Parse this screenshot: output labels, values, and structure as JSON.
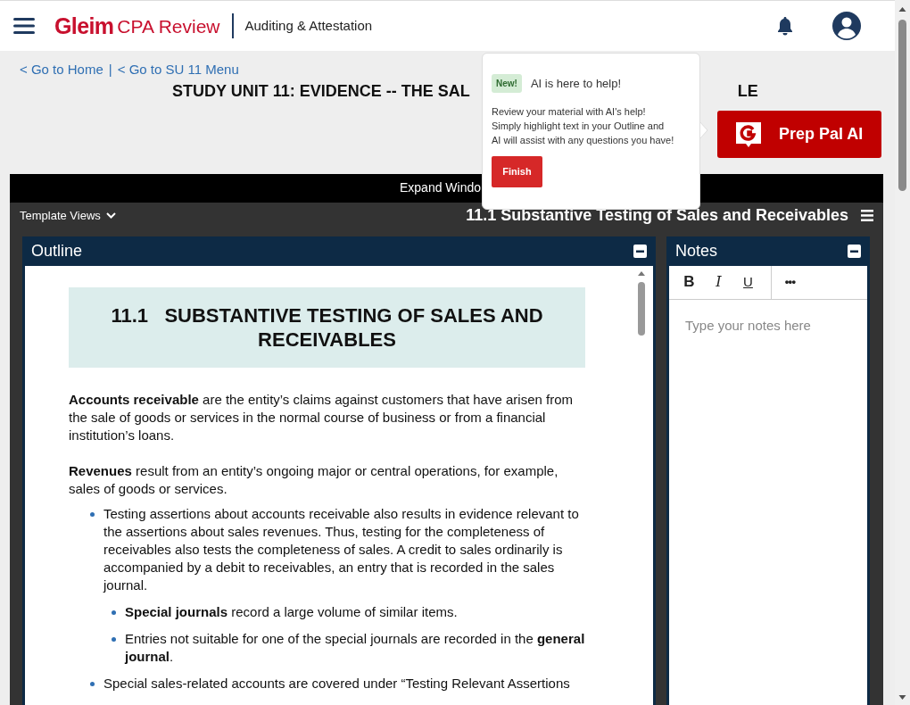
{
  "header": {
    "brand": "Gleim",
    "product": "CPA Review",
    "course": "Auditing & Attestation"
  },
  "breadcrumbs": [
    {
      "label": "< Go to Home"
    },
    {
      "label": "< Go to SU 11 Menu"
    }
  ],
  "breadcrumb_separator": "|",
  "title_parts": [
    "STUDY UNIT 11: EVIDENCE -- THE SAL",
    "LE"
  ],
  "prep_pal_button": {
    "label": "Prep Pal AI"
  },
  "popup": {
    "badge": "New!",
    "title": "AI is here to help!",
    "body": "Review your material with AI's help! Simply highlight text in your Outline and AI will assist with any questions you have!",
    "button": "Finish"
  },
  "expand_bar": {
    "label": "Expand Windo"
  },
  "template_views": {
    "label": "Template Views"
  },
  "section_title": "11.1 Substantive Testing of Sales and Receivables",
  "outline": {
    "title": "Outline",
    "heading_number": "11.1",
    "heading": "SUBSTANTIVE TESTING OF SALES AND RECEIVABLES",
    "paragraphs": [
      "**Accounts receivable** are the entity’s claims against customers that have arisen from the sale of goods or services in the normal course of business or from a financial institution’s loans.",
      "**Revenues** result from an entity’s ongoing major or central operations, for example, sales of goods or services."
    ],
    "bullets": [
      {
        "text": "Testing assertions about accounts receivable also results in evidence relevant to the assertions about sales revenues. Thus, testing for the completeness of receivables also tests the completeness of sales. A credit to sales ordinarily is accompanied by a debit to receivables, an entry that is recorded in the sales journal.",
        "children": [
          {
            "text": "**Special journals** record a large volume of similar items."
          },
          {
            "text": "Entries not suitable for one of the special journals are recorded in the **general journal**."
          }
        ]
      },
      {
        "text": "Special sales-related accounts are covered under “Testing Relevant Assertions"
      }
    ]
  },
  "notes": {
    "title": "Notes",
    "tools": [
      {
        "label": "B",
        "kind": "bold"
      },
      {
        "label": "I",
        "kind": "italic"
      },
      {
        "label": "U",
        "kind": "underline"
      },
      {
        "label": "•••",
        "kind": "more"
      }
    ],
    "placeholder": "Type your notes here"
  }
}
